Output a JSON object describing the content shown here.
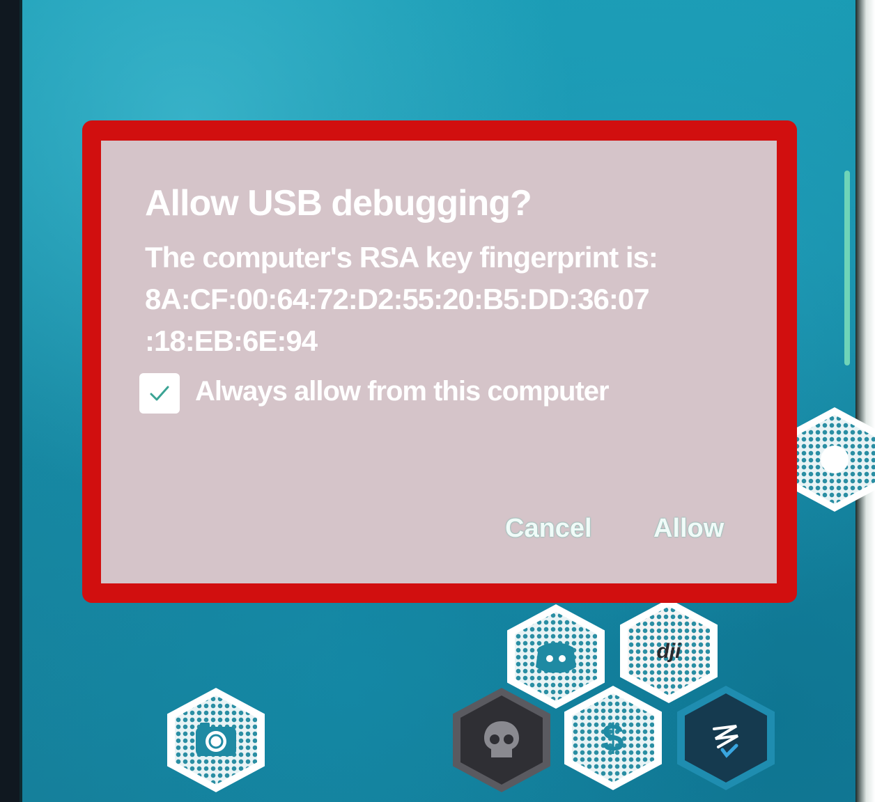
{
  "dialog": {
    "title": "Allow USB debugging?",
    "message_line1": "The computer's RSA key fingerprint is:",
    "fingerprint_line1": "8A:CF:00:64:72:D2:55:20:B5:DD:36:07",
    "fingerprint_line2": ":18:EB:6E:94",
    "checkbox_label": "Always allow from this computer",
    "checkbox_checked": true,
    "cancel_label": "Cancel",
    "allow_label": "Allow"
  },
  "apps": [
    {
      "icon": "camera-icon"
    },
    {
      "icon": "discord-icon"
    },
    {
      "icon": "dji-icon",
      "label": "dji"
    },
    {
      "icon": "skull-icon"
    },
    {
      "icon": "dollar-icon",
      "label": "$"
    },
    {
      "icon": "signature-icon"
    },
    {
      "icon": "app-icon"
    }
  ],
  "colors": {
    "highlight_outline": "#d10f0f",
    "dialog_background": "#d5c4c9",
    "screen_background": "#1789a3"
  }
}
